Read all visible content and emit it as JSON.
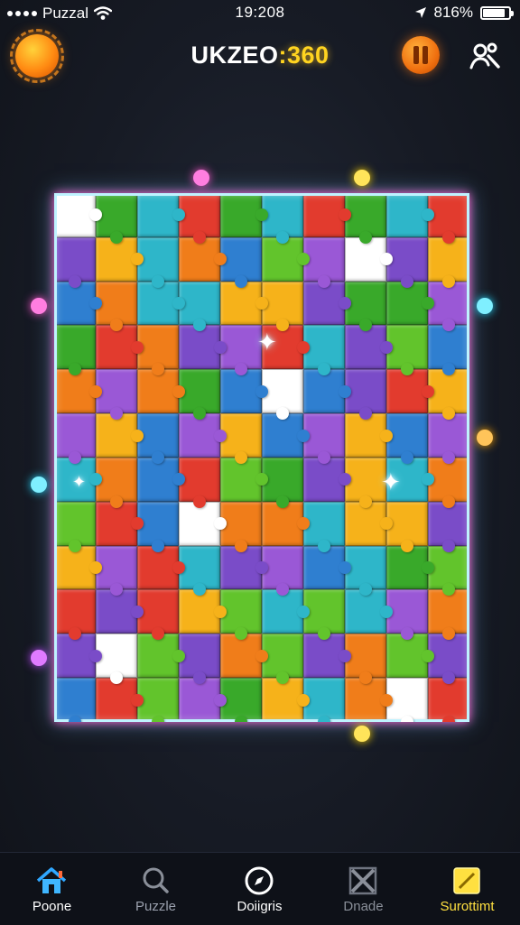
{
  "status_bar": {
    "carrier": "Puzzal",
    "time": "19:208",
    "battery_text": "816%",
    "battery_level": 0.85
  },
  "header": {
    "title_part1": "UKZEO",
    "title_part2": ":360"
  },
  "board": {
    "rows": 12,
    "cols": 10,
    "palette": [
      "#e23b2e",
      "#f07d1a",
      "#f6b21a",
      "#39a92a",
      "#62c42c",
      "#2f7fd0",
      "#2eb6c9",
      "#7a4cc8",
      "#9a58d6",
      "#ffffff"
    ]
  },
  "nav": {
    "items": [
      {
        "label": "Poone",
        "icon": "home-icon",
        "active": true,
        "color": "#ffffff"
      },
      {
        "label": "Puzzle",
        "icon": "search-icon",
        "active": false,
        "color": "#9aa0ad"
      },
      {
        "label": "Doiigris",
        "icon": "compass-icon",
        "active": false,
        "color": "#ffffff"
      },
      {
        "label": "Dnade",
        "icon": "cross-tiles-icon",
        "active": false,
        "color": "#8a8f99"
      },
      {
        "label": "Surottimt",
        "icon": "yellow-square-icon",
        "active": false,
        "color": "#ffe040"
      }
    ]
  }
}
